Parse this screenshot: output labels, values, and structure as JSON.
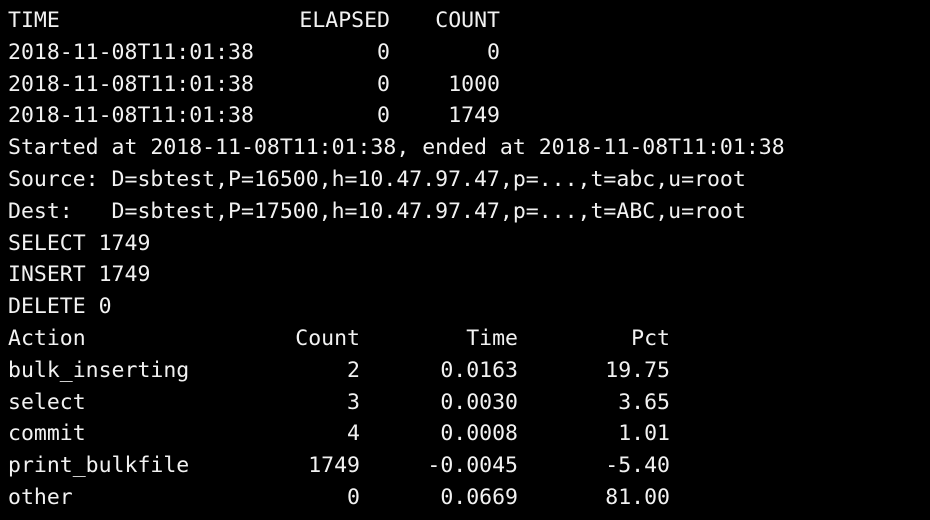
{
  "terminal": {
    "background_color": "#000000",
    "text_color": "#f2f2f2",
    "progress_table": {
      "headers": {
        "time": "TIME",
        "elapsed": "ELAPSED",
        "count": "COUNT"
      },
      "rows": [
        {
          "time": "2018-11-08T11:01:38",
          "elapsed": "0",
          "count": "0"
        },
        {
          "time": "2018-11-08T11:01:38",
          "elapsed": "0",
          "count": "1000"
        },
        {
          "time": "2018-11-08T11:01:38",
          "elapsed": "0",
          "count": "1749"
        }
      ]
    },
    "summary_lines": [
      "Started at 2018-11-08T11:01:38, ended at 2018-11-08T11:01:38",
      "Source: D=sbtest,P=16500,h=10.47.97.47,p=...,t=abc,u=root",
      "Dest:   D=sbtest,P=17500,h=10.47.97.47,p=...,t=ABC,u=root",
      "SELECT 1749",
      "INSERT 1749",
      "DELETE 0"
    ],
    "action_table": {
      "headers": {
        "action": "Action",
        "count": "Count",
        "time": "Time",
        "pct": "Pct"
      },
      "rows": [
        {
          "action": "bulk_inserting",
          "count": "2",
          "time": "0.0163",
          "pct": "19.75"
        },
        {
          "action": "select",
          "count": "3",
          "time": "0.0030",
          "pct": "3.65"
        },
        {
          "action": "commit",
          "count": "4",
          "time": "0.0008",
          "pct": "1.01"
        },
        {
          "action": "print_bulkfile",
          "count": "1749",
          "time": "-0.0045",
          "pct": "-5.40"
        },
        {
          "action": "other",
          "count": "0",
          "time": "0.0669",
          "pct": "81.00"
        }
      ]
    }
  }
}
